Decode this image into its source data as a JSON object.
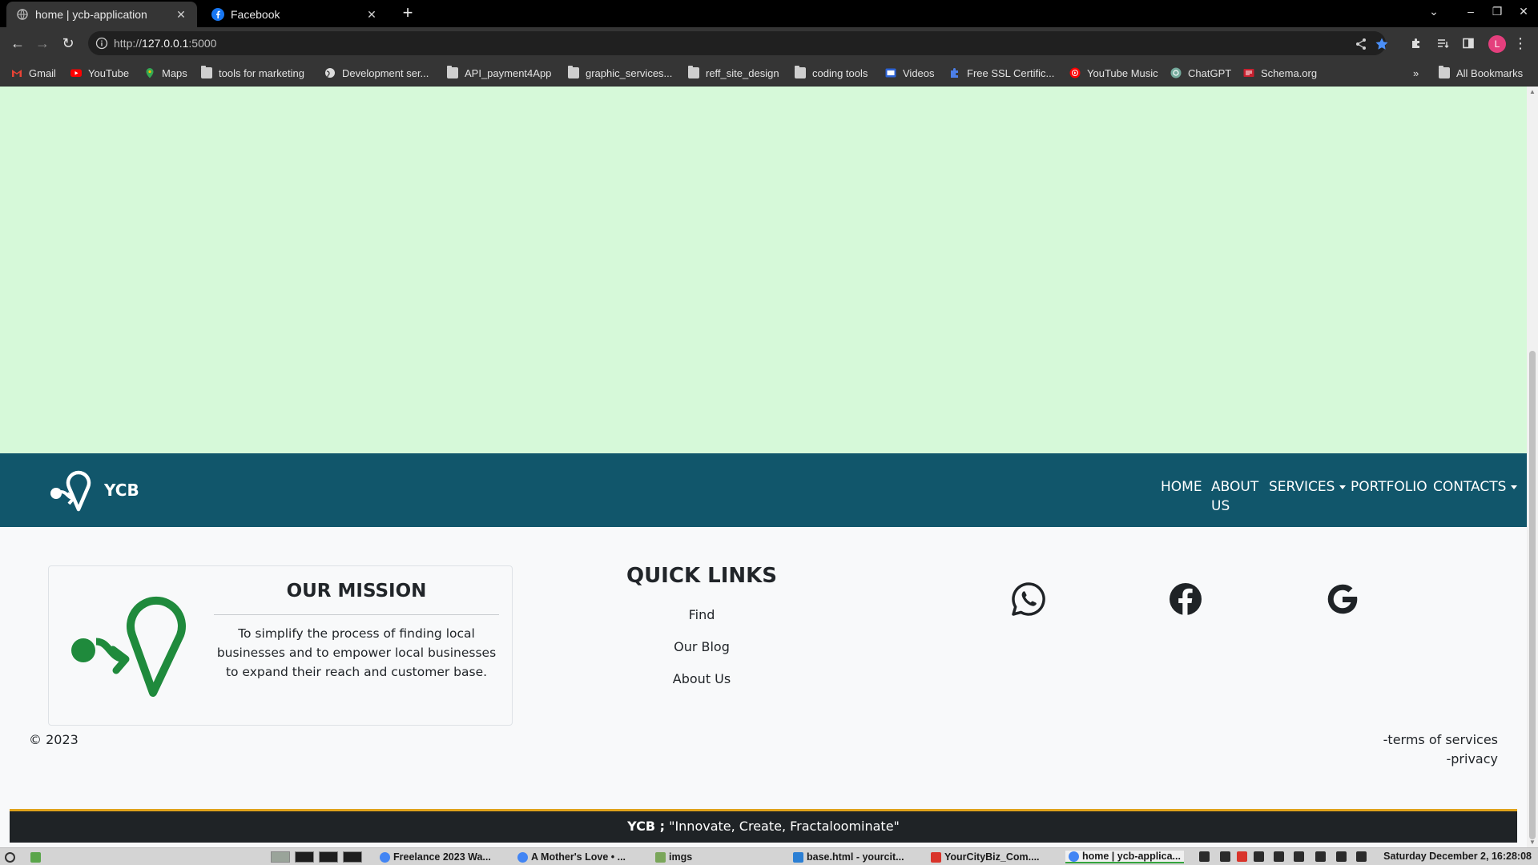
{
  "browser": {
    "tabs": [
      {
        "title": "home | ycb-application",
        "active": true,
        "favicon": "globe-icon"
      },
      {
        "title": "Facebook",
        "active": false,
        "favicon": "facebook-icon"
      }
    ],
    "url_prefix": "http://",
    "url_host": "127.0.0.1",
    "url_rest": ":5000",
    "profile_initial": "L",
    "bookmarks": [
      {
        "label": "Gmail",
        "icon": "gmail-icon"
      },
      {
        "label": "YouTube",
        "icon": "youtube-icon"
      },
      {
        "label": "Maps",
        "icon": "maps-icon"
      },
      {
        "label": "tools for marketing",
        "icon": "folder-icon"
      },
      {
        "label": "Development ser...",
        "icon": "globe-icon"
      },
      {
        "label": "API_payment4App",
        "icon": "folder-icon"
      },
      {
        "label": "graphic_services...",
        "icon": "folder-icon"
      },
      {
        "label": "reff_site_design",
        "icon": "folder-icon"
      },
      {
        "label": "coding tools",
        "icon": "folder-icon"
      },
      {
        "label": "Videos",
        "icon": "video-icon"
      },
      {
        "label": "Free SSL Certific...",
        "icon": "puzzle-icon"
      },
      {
        "label": "YouTube Music",
        "icon": "youtube-music-icon"
      },
      {
        "label": "ChatGPT",
        "icon": "chatgpt-icon"
      },
      {
        "label": "Schema.org",
        "icon": "schema-icon"
      }
    ],
    "overflow_label": "»",
    "all_bookmarks": "All Bookmarks"
  },
  "page": {
    "brand": "YCB",
    "nav": {
      "home": "HOME",
      "about_line1": "ABOUT",
      "about_line2": "US",
      "services": "SERVICES",
      "portfolio": "PORTFOLIO",
      "contacts": "CONTACTS"
    },
    "mission": {
      "title": "OUR MISSION",
      "text": "To simplify the process of finding local businesses and to empower local businesses to expand their reach and customer base."
    },
    "quick_links": {
      "title": "QUICK LINKS",
      "items": [
        "Find",
        "Our Blog",
        "About Us"
      ]
    },
    "social": [
      "whatsapp-icon",
      "facebook-icon",
      "google-icon"
    ],
    "copyright": "© 2023",
    "terms": "-terms of services",
    "privacy": "-privacy",
    "tagline_brand": "YCB ;",
    "tagline_quote": " \"Innovate, Create, Fractaloominate\"",
    "colors": {
      "hero_bg": "#d6f9d9",
      "navbar_bg": "#11566b",
      "logo_green": "#1f8a3c",
      "tagline_bg": "#1f2326",
      "tagline_border": "#e0a31b"
    }
  },
  "taskbar": {
    "apps": [
      {
        "label": "Freelance 2023 Wa...",
        "icon": "chrome-icon"
      },
      {
        "label": "A Mother's Love • ...",
        "icon": "chrome-icon"
      },
      {
        "label": "imgs",
        "icon": "folder-icon"
      },
      {
        "label": "base.html - yourcit...",
        "icon": "vscode-icon"
      },
      {
        "label": "YourCityBiz_Com....",
        "icon": "wps-icon"
      },
      {
        "label": "home | ycb-applica...",
        "icon": "chrome-icon",
        "active": true
      }
    ],
    "clock": "Saturday December  2, 16:28:08"
  }
}
